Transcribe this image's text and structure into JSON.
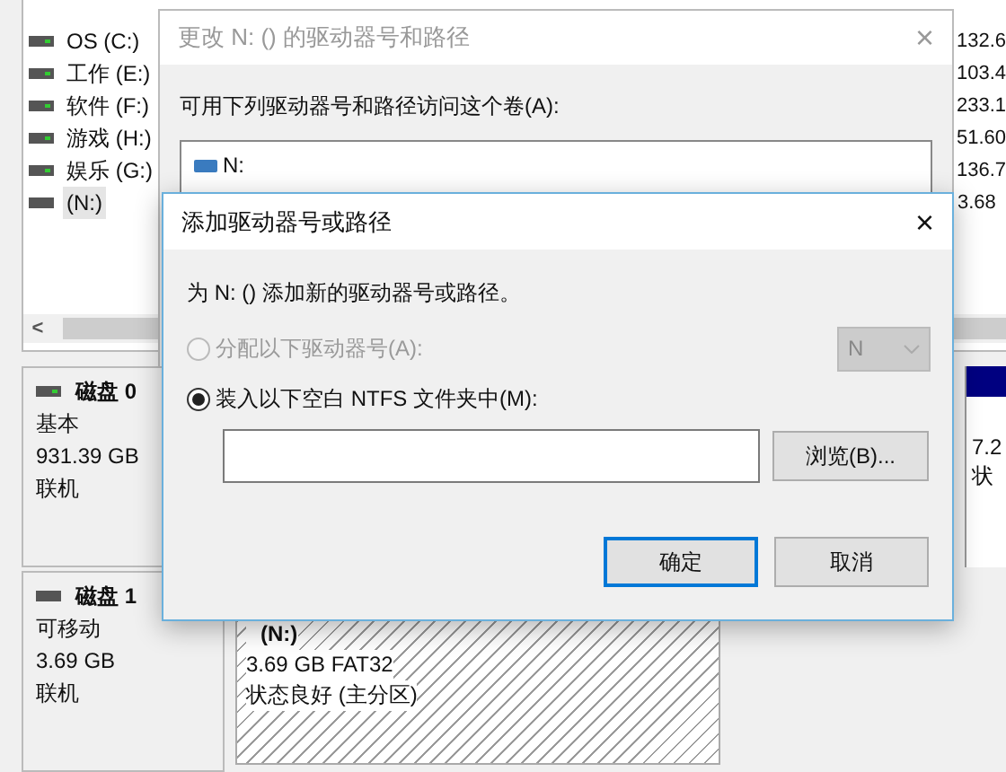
{
  "disk_management": {
    "volumes": [
      {
        "name": "OS (C:)",
        "capacity": "132.6",
        "selected": false,
        "kind": "fixed"
      },
      {
        "name": "工作 (E:)",
        "capacity": "103.4",
        "selected": false,
        "kind": "fixed"
      },
      {
        "name": "软件 (F:)",
        "capacity": "233.1",
        "selected": false,
        "kind": "fixed"
      },
      {
        "name": "游戏 (H:)",
        "capacity": "51.60",
        "selected": false,
        "kind": "fixed"
      },
      {
        "name": "娱乐 (G:)",
        "capacity": "136.7",
        "selected": false,
        "kind": "fixed"
      },
      {
        "name": "(N:)",
        "capacity": "3.68",
        "selected": true,
        "kind": "removable"
      }
    ],
    "scroll_left": "<",
    "disks": [
      {
        "name": "磁盘 0",
        "kind": "fixed",
        "type": "基本",
        "size": "931.39 GB",
        "status": "联机",
        "partition": {
          "kind": "primary",
          "size": "7.2",
          "status": "状"
        }
      },
      {
        "name": "磁盘 1",
        "kind": "removable",
        "type": "可移动",
        "size": "3.69 GB",
        "status": "联机",
        "partition": {
          "kind": "selected",
          "label": "(N:)",
          "size": "3.69 GB FAT32",
          "status": "状态良好 (主分区)"
        }
      }
    ]
  },
  "change_dialog": {
    "title": "更改 N: () 的驱动器号和路径",
    "close": "×",
    "prompt": "可用下列驱动器号和路径访问这个卷(A):",
    "paths": [
      "N:"
    ]
  },
  "add_dialog": {
    "title": "添加驱动器号或路径",
    "close": "×",
    "prompt": "为 N: () 添加新的驱动器号或路径。",
    "options": [
      {
        "kind": "letter",
        "label": "分配以下驱动器号(A):",
        "selected": false,
        "disabled": true,
        "value": "N"
      },
      {
        "kind": "folder",
        "label": "装入以下空白 NTFS 文件夹中(M):",
        "selected": true,
        "disabled": false,
        "browse": "浏览(B)..."
      }
    ],
    "buttons": [
      {
        "label": "确定",
        "focused": true
      },
      {
        "label": "取消",
        "focused": false
      }
    ]
  }
}
